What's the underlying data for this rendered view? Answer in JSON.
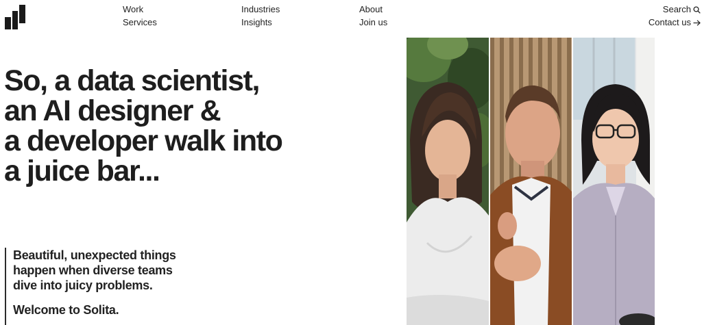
{
  "nav": {
    "col1": [
      "Work",
      "Services"
    ],
    "col2": [
      "Industries",
      "Insights"
    ],
    "col3": [
      "About",
      "Join us"
    ],
    "search_label": "Search",
    "contact_label": "Contact us",
    "search_icon": "search-icon",
    "contact_icon": "arrow-right-icon"
  },
  "hero": {
    "headline_lines": [
      "So, a data scientist,",
      "an AI designer &",
      "a developer walk into",
      "a juice bar..."
    ],
    "intro": "Beautiful, unexpected things happen when diverse teams dive into juicy problems.",
    "welcome": "Welcome to Solita."
  },
  "colors": {
    "text": "#1e1e1e",
    "background": "#ffffff"
  }
}
